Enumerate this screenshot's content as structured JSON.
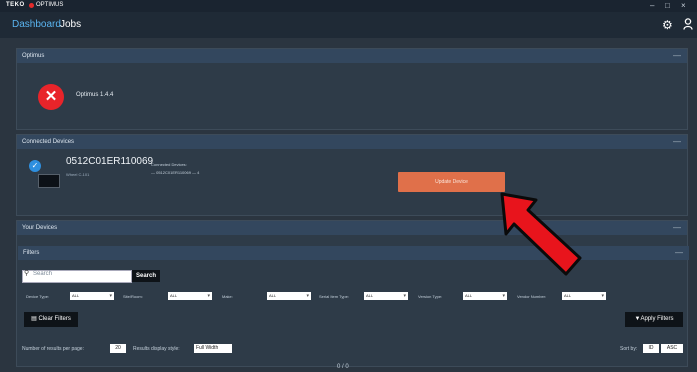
{
  "titlebar": {
    "brand": "TEKO",
    "app_name": "OPTIMUS",
    "minimize": "–",
    "maximize": "□",
    "close": "×"
  },
  "nav": {
    "dashboard": "Dashboard",
    "jobs": "Jobs"
  },
  "optimus": {
    "header": "Optimus",
    "version": "Optimus 1.4.4",
    "collapse": "—"
  },
  "connected_devices": {
    "header": "Connected Devices",
    "collapse": "—",
    "serial": "0512C01ER110069",
    "device_sub": "Wheel C-101",
    "connected_label": "Connected Devices:",
    "connected_value": "— 0512C01ER110069 — 4",
    "update_button": "Update Device"
  },
  "your_devices": {
    "header": "Your Devices",
    "collapse": "—",
    "filters_header": "Filters",
    "filters_collapse": "—",
    "search_placeholder": "Search",
    "search_button": "Search",
    "filters": [
      {
        "label": "Device Type:",
        "value": "ALL"
      },
      {
        "label": "Site/Room:",
        "value": "ALL"
      },
      {
        "label": "Make:",
        "value": "ALL"
      },
      {
        "label": "Serial Item Type:",
        "value": "ALL"
      },
      {
        "label": "Version Type:",
        "value": "ALL"
      },
      {
        "label": "Vendor Number:",
        "value": "ALL"
      }
    ],
    "clear_filters": "Clear Filters",
    "apply_filters": "Apply Filters",
    "per_page_label": "Number of results per page:",
    "per_page_value": "20",
    "display_style_label": "Results display style:",
    "display_style_value": "Full Width",
    "sort_by_label": "Sort by:",
    "sort_field": "ID",
    "sort_dir": "ASC",
    "pager": "0 / 0"
  },
  "colors": {
    "accent": "#5ab4f0",
    "update": "#e0704a",
    "arrow": "#e8141c",
    "logo": "#e8242a"
  }
}
